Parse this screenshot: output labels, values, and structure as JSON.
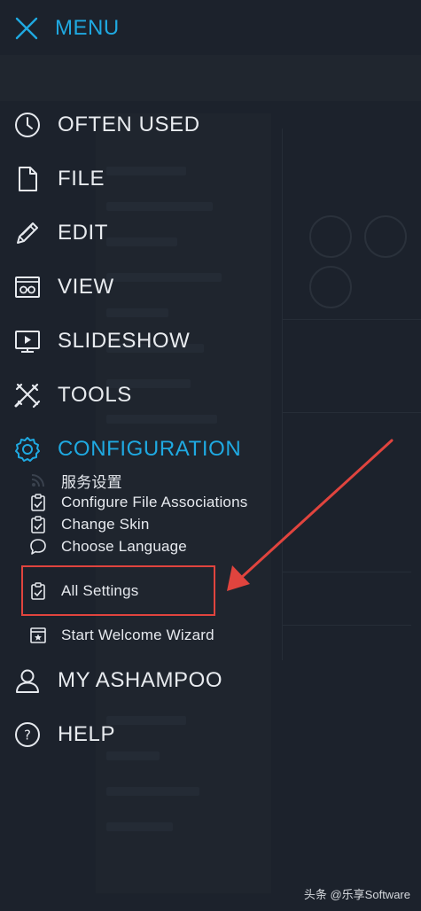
{
  "menu": {
    "title": "MENU",
    "items": [
      {
        "label": "OFTEN USED",
        "icon": "clock-icon"
      },
      {
        "label": "FILE",
        "icon": "document-icon"
      },
      {
        "label": "EDIT",
        "icon": "pencil-icon"
      },
      {
        "label": "VIEW",
        "icon": "glasses-window-icon"
      },
      {
        "label": "SLIDESHOW",
        "icon": "play-screen-icon"
      },
      {
        "label": "TOOLS",
        "icon": "crossed-tools-icon"
      },
      {
        "label": "CONFIGURATION",
        "icon": "gear-icon",
        "active": true
      },
      {
        "label": "MY ASHAMPOO",
        "icon": "user-icon"
      },
      {
        "label": "HELP",
        "icon": "question-circle-icon"
      }
    ],
    "configuration_subitems": [
      {
        "label": "服务设置",
        "icon": "rss-icon"
      },
      {
        "label": "Configure File Associations",
        "icon": "clipboard-check-icon"
      },
      {
        "label": "Change Skin",
        "icon": "clipboard-check-icon"
      },
      {
        "label": "Choose Language",
        "icon": "speech-bubble-icon"
      },
      {
        "label": "All Settings",
        "icon": "clipboard-check-icon",
        "highlighted": true
      },
      {
        "label": "Start Welcome Wizard",
        "icon": "star-window-icon"
      }
    ]
  },
  "colors": {
    "accent": "#1fa9e1",
    "highlight": "#e0443e",
    "background": "#1c222c"
  },
  "watermark": "头条 @乐享Software"
}
